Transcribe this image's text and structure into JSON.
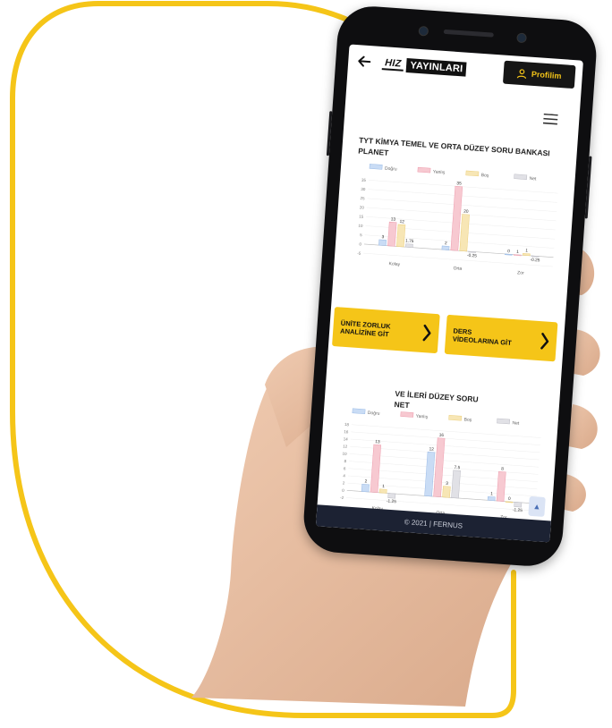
{
  "header": {
    "logo_part1": "HIZ",
    "logo_part2": "YAYINLARI",
    "profile_label": "Profilim"
  },
  "sections": [
    {
      "title": "TYT KİMYA TEMEL VE ORTA DÜZEY SORU BANKASI PLANET"
    },
    {
      "title_visible_part": "VE İLERİ DÜZEY SORU",
      "title_line2_part": "NET"
    }
  ],
  "actions": {
    "unite_label": "ÜNİTE ZORLUK ANALİZİNE GİT",
    "ders_label": "DERS VİDEOLARINA GİT"
  },
  "footer": {
    "text": "© 2021 | FERNUS"
  },
  "colors": {
    "accent": "#f5c518",
    "dark": "#161616",
    "footer": "#1c2233",
    "dogru": "#c9dcf5",
    "yanlis": "#f7c9d1",
    "bos": "#f7e6b5",
    "net": "#e1e1e6"
  },
  "chart_data": [
    {
      "type": "bar",
      "legend": [
        "Doğru",
        "Yanlış",
        "Boş",
        "Net"
      ],
      "categories": [
        "Kolay",
        "Orta",
        "Zor"
      ],
      "ylim": [
        -5,
        35
      ],
      "yticks": [
        "35",
        "30",
        "25",
        "20",
        "15",
        "10",
        "5",
        "0",
        "-5"
      ],
      "series": [
        {
          "name": "Doğru",
          "values": [
            3,
            2,
            0
          ]
        },
        {
          "name": "Yanlış",
          "values": [
            13,
            35,
            0
          ]
        },
        {
          "name": "Boş",
          "values": [
            12,
            20,
            1
          ]
        },
        {
          "name": "Net",
          "values": [
            1.75,
            -0.25,
            -0.25
          ]
        }
      ],
      "labels": [
        [
          "3",
          "13",
          "12",
          "1.75"
        ],
        [
          "2",
          "35",
          "20",
          "-0.25"
        ],
        [
          "0",
          "1",
          "1",
          "-0.25"
        ]
      ]
    },
    {
      "type": "bar",
      "legend": [
        "Doğru",
        "Yanlış",
        "Boş",
        "Net"
      ],
      "categories": [
        "Kolay",
        "Orta",
        "Zor"
      ],
      "ylim": [
        -2,
        18
      ],
      "yticks": [
        "18",
        "16",
        "14",
        "12",
        "10",
        "8",
        "6",
        "4",
        "2",
        "0",
        "-2"
      ],
      "series": [
        {
          "name": "Doğru",
          "values": [
            2,
            12,
            1
          ]
        },
        {
          "name": "Yanlış",
          "values": [
            13,
            16,
            8
          ]
        },
        {
          "name": "Boş",
          "values": [
            1,
            3,
            0
          ]
        },
        {
          "name": "Net",
          "values": [
            -1.25,
            7.5,
            -1.25
          ]
        }
      ],
      "labels": [
        [
          "2",
          "13",
          "1",
          "-1.25"
        ],
        [
          "12",
          "16",
          "3",
          "7.5"
        ],
        [
          "1",
          "8",
          "0",
          "-1.25"
        ]
      ]
    }
  ]
}
